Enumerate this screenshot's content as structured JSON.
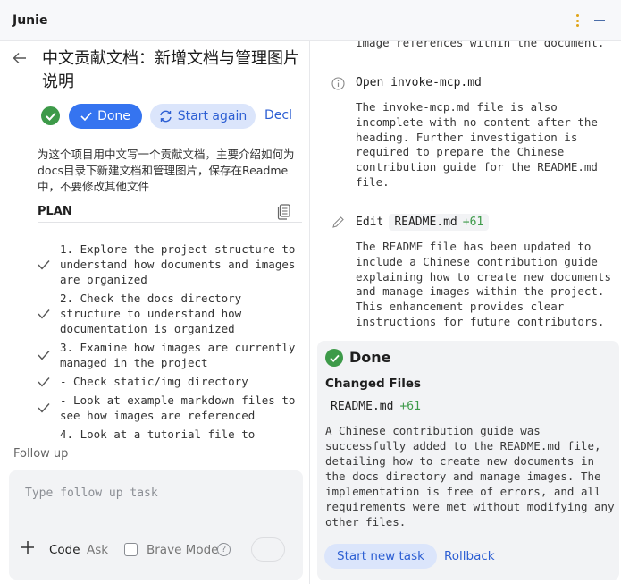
{
  "app": {
    "title": "Junie"
  },
  "task": {
    "title": "中文贡献文档：新增文档与管理图片说明",
    "done_label": "Done",
    "start_again_label": "Start again",
    "decline_label": "Decli",
    "prompt": "为这个项目用中文写一个贡献文档，主要介绍如何为docs目录下新建文档和管理图片，保存在Readme中，不要修改其他文件"
  },
  "plan": {
    "label": "PLAN",
    "items": [
      "1. Explore the project structure to understand how documents and images are organized",
      "2. Check the docs directory structure to understand how documentation is organized",
      "3. Examine how images are currently managed in the project",
      "- Check static/img directory",
      "- Look at example markdown files to see how images are referenced",
      "4. Look at a tutorial file to"
    ]
  },
  "followup": {
    "label": "Follow up",
    "placeholder": "Type follow up task",
    "mode_code": "Code",
    "mode_ask": "Ask",
    "brave_mode": "Brave Mode",
    "help": "?"
  },
  "log": {
    "top_line": "image references within the document.",
    "step1_label": "Open invoke-mcp.md",
    "step1_text": "The invoke-mcp.md file is also incomplete with no content after the heading. Further investigation is required to prepare the Chinese contribution guide for the README.md file.",
    "step2_action": "Edit",
    "step2_file": "README.md",
    "step2_delta": "+61",
    "step2_text": "The README file has been updated to include a Chinese contribution guide explaining how to create new documents and manage images within the project. This enhancement provides clear instructions for future contributors."
  },
  "summary": {
    "title": "Done",
    "changed_files_label": "Changed Files",
    "file_name": "README.md",
    "file_delta": "+61",
    "text": "A Chinese contribution guide was successfully added to the README.md file, detailing how to create new documents in the docs directory and manage images. The implementation is free of errors, and all requirements were met without modifying any other files.",
    "start_new_label": "Start new task",
    "rollback_label": "Rollback"
  },
  "colors": {
    "accent": "#3574f0",
    "success": "#3d9a49",
    "link": "#2d5fd3",
    "panel": "#f2f3f5"
  },
  "icons": [
    "kebab-menu-icon",
    "minimize-icon",
    "back-arrow-icon",
    "check-icon",
    "refresh-icon",
    "copy-icon",
    "info-icon",
    "pencil-icon",
    "plus-icon",
    "help-icon",
    "send-icon"
  ]
}
